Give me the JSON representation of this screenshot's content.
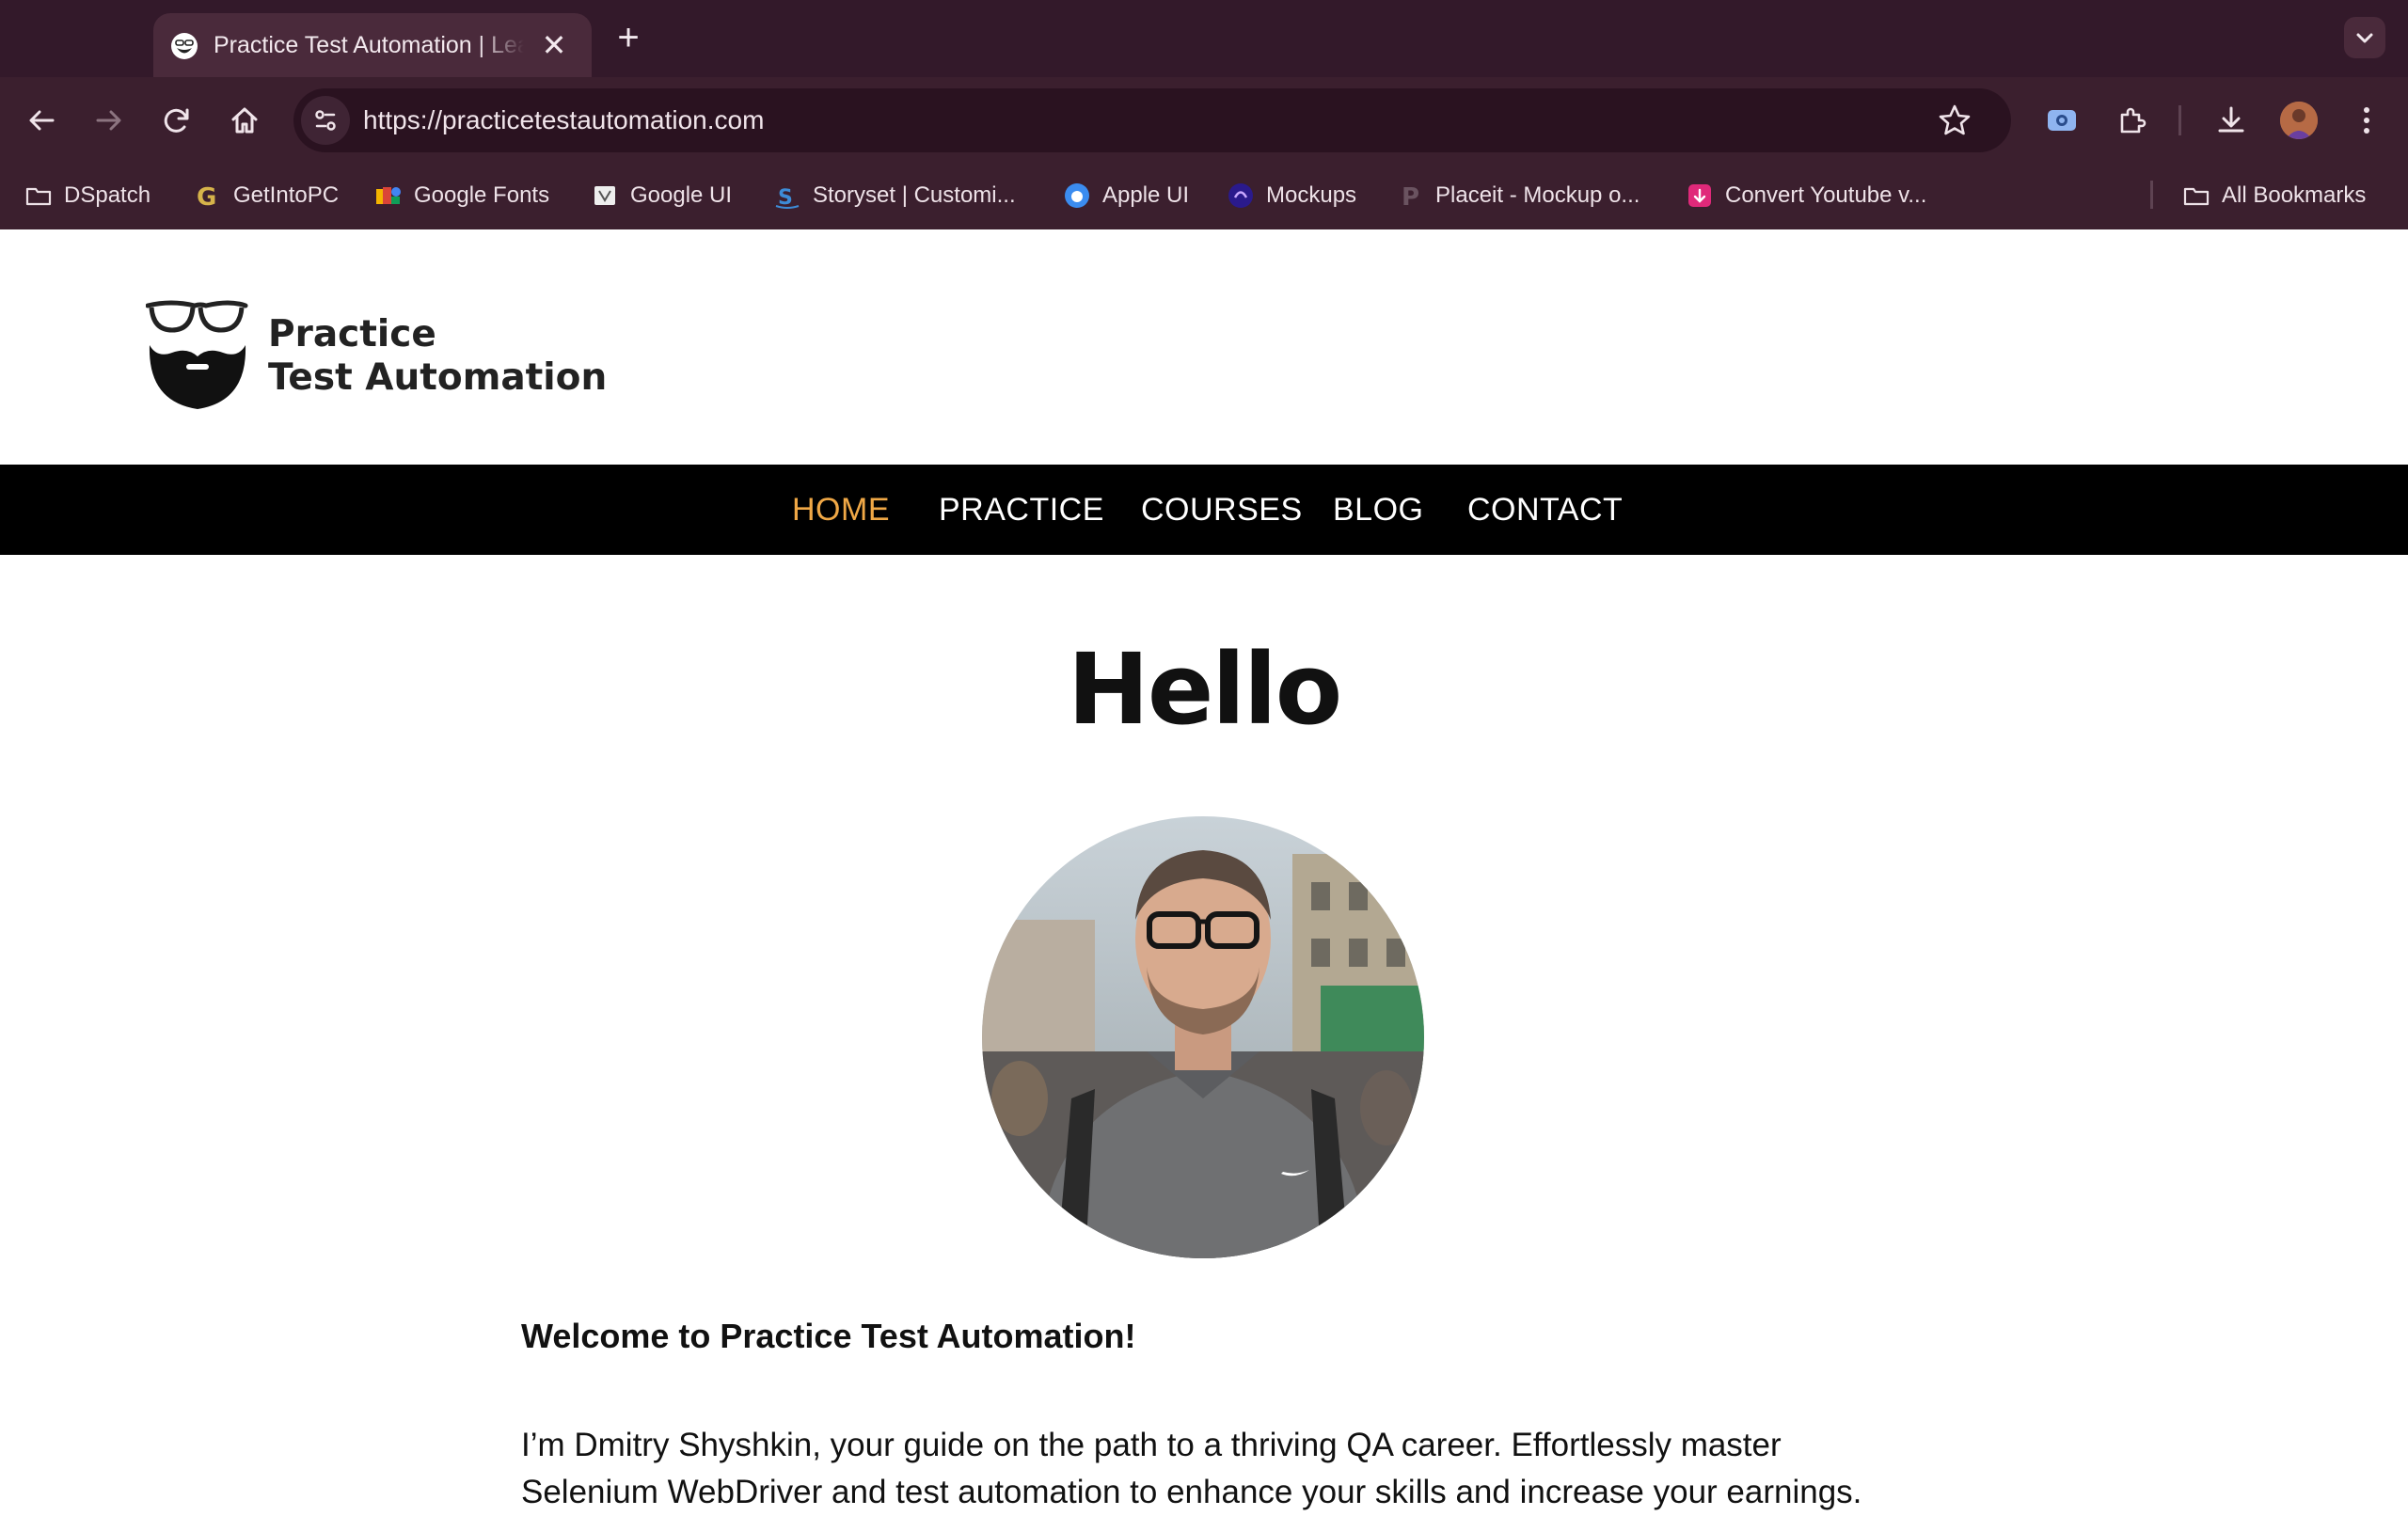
{
  "browser": {
    "tab": {
      "title": "Practice Test Automation | Learn Selenium WebDriver",
      "close_glyph": "✕"
    },
    "new_tab_glyph": "+",
    "address_bar": {
      "url": "https://practicetestautomation.com"
    },
    "bookmarks": [
      {
        "label": "DSpatch",
        "icon": "folder-icon"
      },
      {
        "label": "GetIntoPC",
        "icon": "getintopc-icon"
      },
      {
        "label": "Google Fonts",
        "icon": "google-fonts-icon"
      },
      {
        "label": "Google UI",
        "icon": "google-ui-icon"
      },
      {
        "label": "Storyset | Customi...",
        "icon": "storyset-icon"
      },
      {
        "label": "Apple UI",
        "icon": "apple-ui-icon"
      },
      {
        "label": "Mockups",
        "icon": "mockups-icon"
      },
      {
        "label": "Placeit - Mockup o...",
        "icon": "placeit-icon"
      },
      {
        "label": "Convert Youtube v...",
        "icon": "mp3-converter-icon"
      }
    ],
    "all_bookmarks_label": "All Bookmarks"
  },
  "site": {
    "logo": {
      "line1": "Practice",
      "line2": "Test Automation"
    },
    "nav": [
      {
        "label": "HOME",
        "active": true
      },
      {
        "label": "PRACTICE",
        "active": false
      },
      {
        "label": "COURSES",
        "active": false
      },
      {
        "label": "BLOG",
        "active": false
      },
      {
        "label": "CONTACT",
        "active": false
      }
    ],
    "accent_color": "#f0a846"
  },
  "main": {
    "heading": "Hello",
    "welcome": "Welcome to Practice Test Automation!",
    "intro": "I’m Dmitry Shyshkin, your guide on the path to a thriving QA career. Effortlessly master Selenium WebDriver and test automation to enhance your skills and increase your earnings."
  }
}
